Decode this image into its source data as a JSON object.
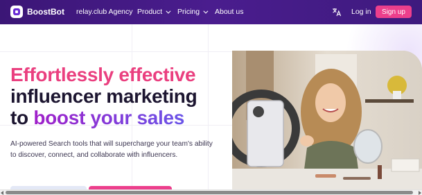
{
  "brand": {
    "name": "BoostBot"
  },
  "nav": {
    "agency": "relay.club Agency",
    "product": "Product",
    "pricing": "Pricing",
    "about": "About us",
    "login": "Log in",
    "signup": "Sign up"
  },
  "hero": {
    "line1": "Effortlessly effective",
    "line2": "influencer marketing",
    "line3_prefix": "to ",
    "line3_highlight": "boost your sales",
    "paragraph": "AI-powered Search tools that will supercharge your team's ability to discover, connect, and collaborate with influencers."
  },
  "colors": {
    "nav_bg": "#3b1676",
    "accent_pink": "#ec3f8c",
    "headline_pink": "#ea3f7f",
    "headline_dark": "#1c1530",
    "highlight_purple": "#7c3ae0"
  },
  "icons": {
    "translate": "translate-icon",
    "chevron": "chevron-down-icon",
    "logo": "boostbot-logo-icon"
  }
}
